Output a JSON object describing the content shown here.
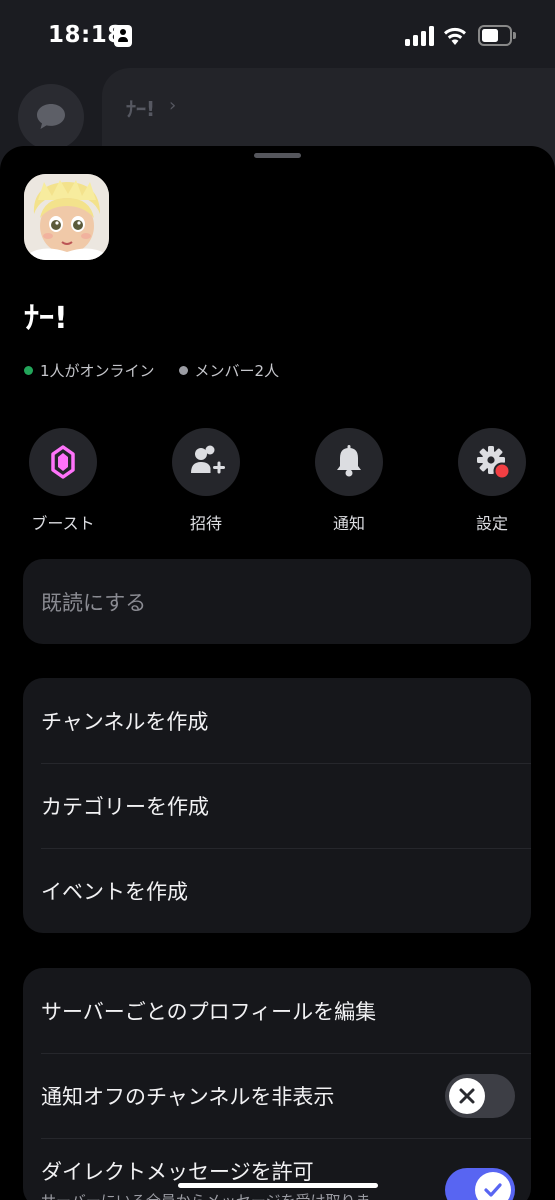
{
  "status_bar": {
    "time": "18:18"
  },
  "background": {
    "server_name": "ﾅｰ!",
    "chevron": "›"
  },
  "server": {
    "name": "ﾅｰ!",
    "online_text": "1人がオンライン",
    "members_text": "メンバー2人"
  },
  "actions": [
    {
      "label": "ブースト",
      "icon": "boost-icon"
    },
    {
      "label": "招待",
      "icon": "invite-icon"
    },
    {
      "label": "通知",
      "icon": "bell-icon"
    },
    {
      "label": "設定",
      "icon": "gear-icon"
    }
  ],
  "mark_read": {
    "label": "既読にする"
  },
  "create": {
    "channel": "チャンネルを作成",
    "category": "カテゴリーを作成",
    "event": "イベントを作成"
  },
  "settings": {
    "edit_profile": "サーバーごとのプロフィールを編集",
    "hide_muted": "通知オフのチャンネルを非表示",
    "hide_muted_on": false,
    "allow_dm": "ダイレクトメッセージを許可",
    "allow_dm_sub": "サーバーにいる全員からメッセージを受け取りま",
    "allow_dm_on": true
  },
  "colors": {
    "accent": "#5865f2",
    "online": "#23a55a",
    "boost": "#ff73fa",
    "alert": "#f23f43"
  }
}
